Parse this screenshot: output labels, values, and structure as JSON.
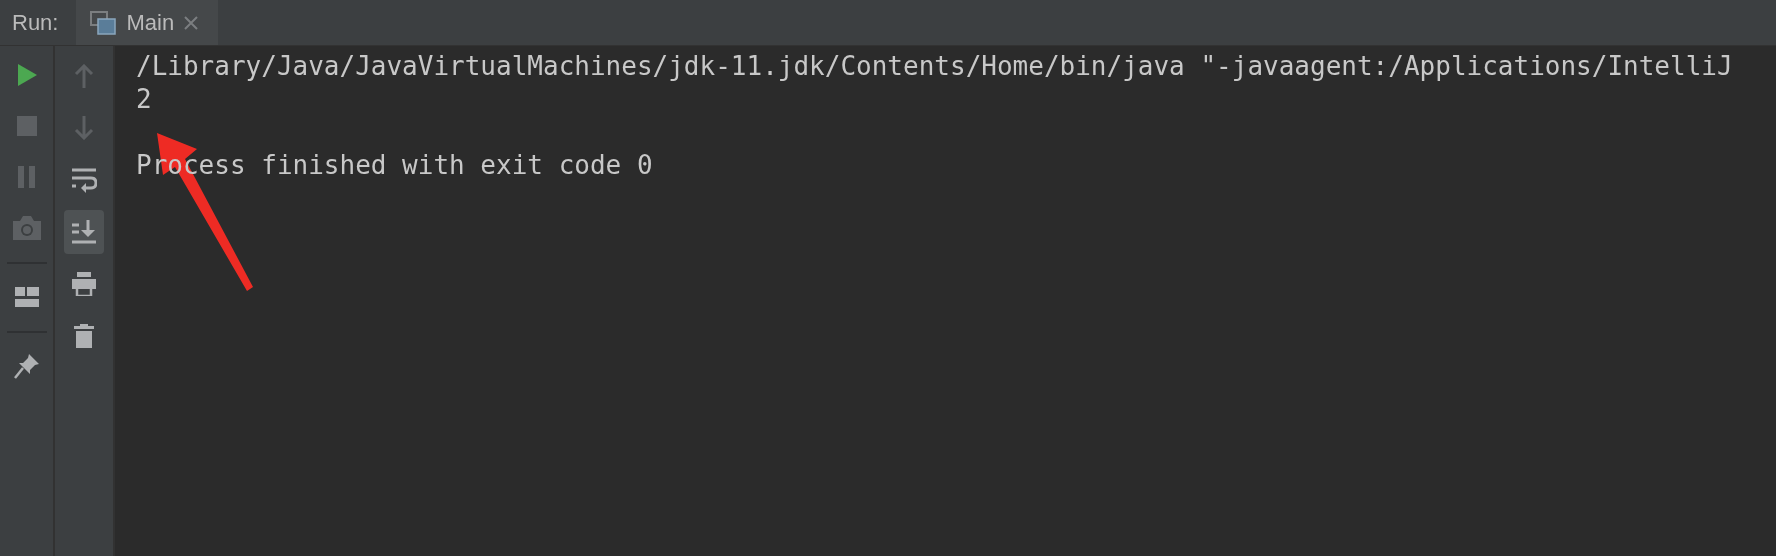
{
  "header": {
    "label": "Run:",
    "tabs": [
      {
        "title": "Main"
      }
    ]
  },
  "left_toolbar": [
    {
      "kind": "run",
      "disabled": false
    },
    {
      "kind": "stop",
      "disabled": true
    },
    {
      "kind": "pause",
      "disabled": true
    },
    {
      "kind": "camera",
      "disabled": true
    },
    {
      "kind": "separator"
    },
    {
      "kind": "layout",
      "disabled": false
    },
    {
      "kind": "separator"
    },
    {
      "kind": "pin",
      "disabled": false
    }
  ],
  "right_toolbar": [
    {
      "kind": "up",
      "disabled": true,
      "selected": false
    },
    {
      "kind": "down",
      "disabled": true,
      "selected": false
    },
    {
      "kind": "wrap",
      "disabled": false,
      "selected": false
    },
    {
      "kind": "scroll-end",
      "disabled": false,
      "selected": true
    },
    {
      "kind": "print",
      "disabled": false,
      "selected": false
    },
    {
      "kind": "trash",
      "disabled": false,
      "selected": false
    }
  ],
  "console": {
    "output": [
      "/Library/Java/JavaVirtualMachines/jdk-11.jdk/Contents/Home/bin/java \"-javaagent:/Applications/IntelliJ",
      "2"
    ],
    "exit_message": "Process finished with exit code 0"
  }
}
